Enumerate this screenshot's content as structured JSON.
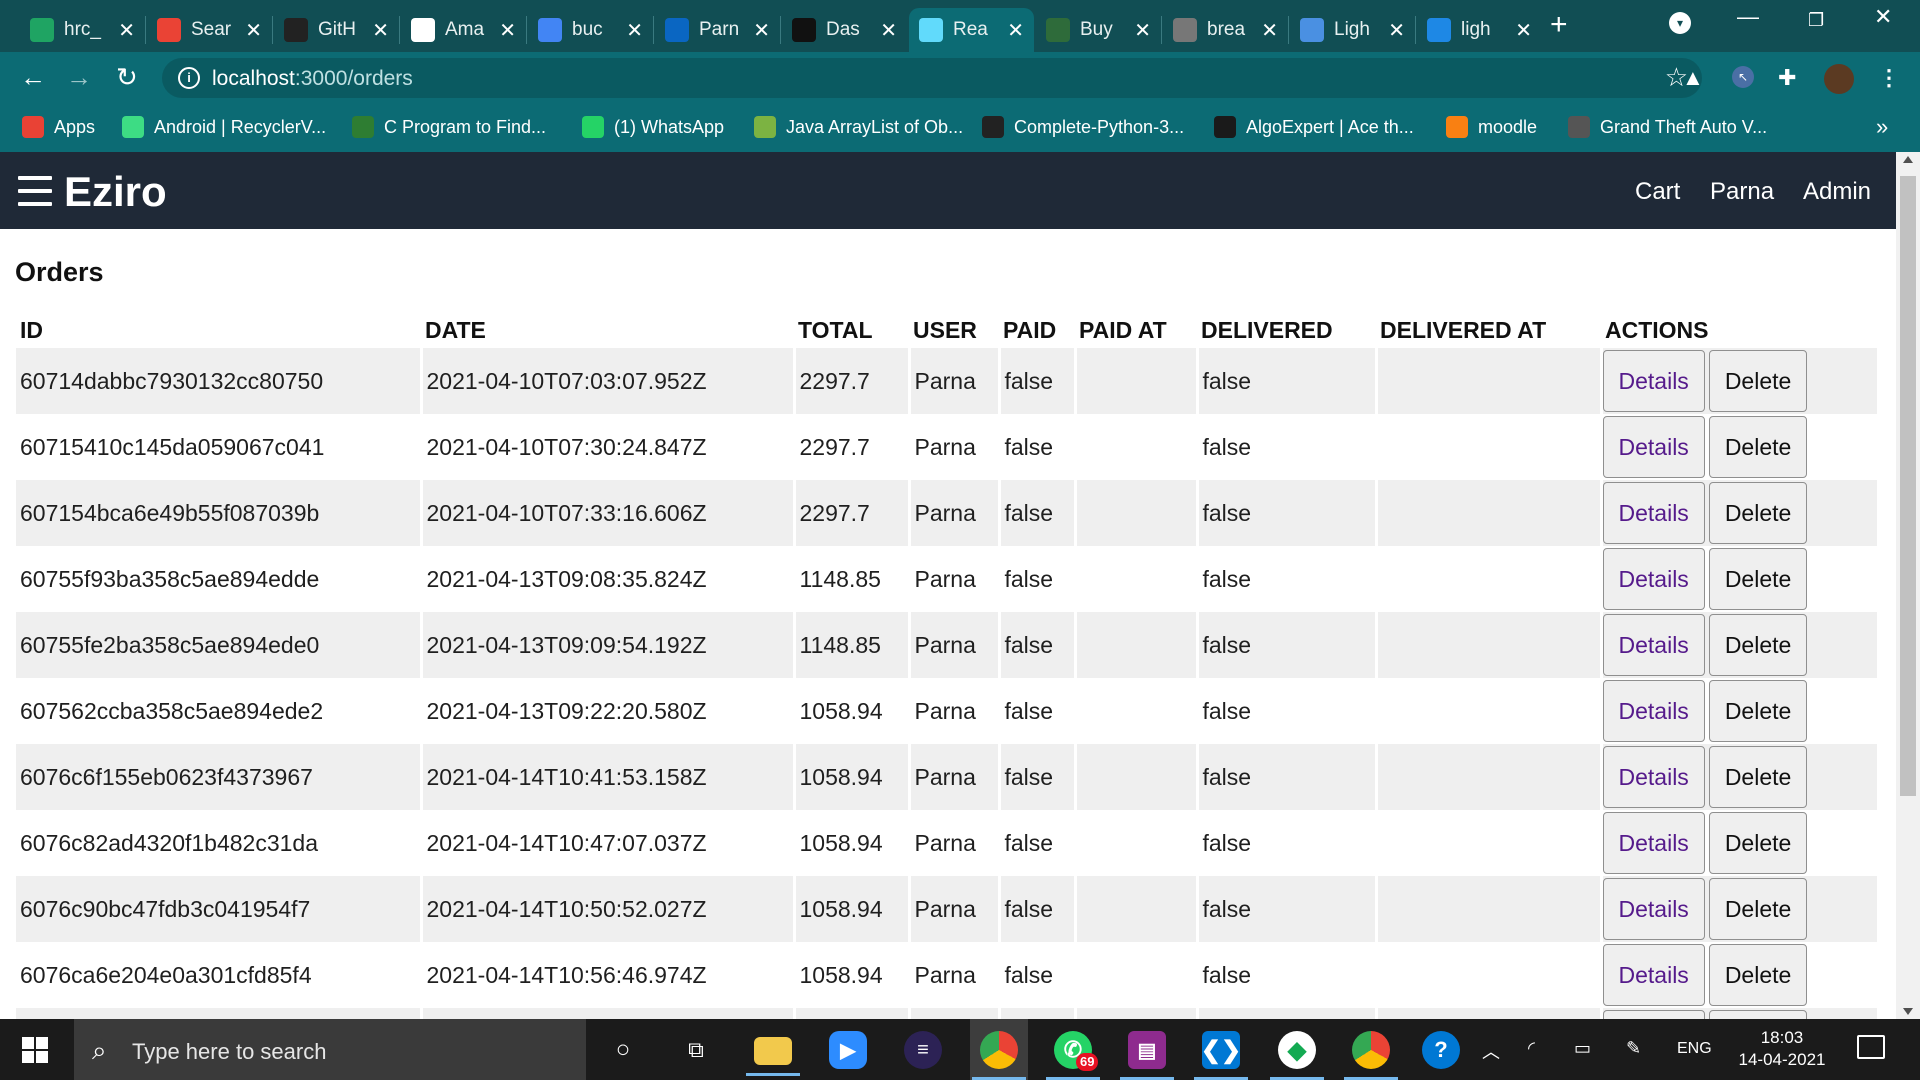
{
  "browser": {
    "tabs": [
      {
        "title": "hrc_",
        "icon": "google-drive-icon",
        "color": "#1fa463"
      },
      {
        "title": "Sear",
        "icon": "gmail-icon",
        "color": "#ea4335"
      },
      {
        "title": "GitH",
        "icon": "github-icon",
        "color": "#222222"
      },
      {
        "title": "Ama",
        "icon": "amazon-icon",
        "color": "#ffffff"
      },
      {
        "title": "buc",
        "icon": "google-icon",
        "color": "#4285f4"
      },
      {
        "title": "Parn",
        "icon": "linkedin-icon",
        "color": "#0a66c2"
      },
      {
        "title": "Das",
        "icon": "dashboard-icon",
        "color": "#111111"
      },
      {
        "title": "Rea",
        "icon": "react-icon",
        "color": "#61dafb"
      },
      {
        "title": "Buy",
        "icon": "shop-icon",
        "color": "#2e6b3a"
      },
      {
        "title": "brea",
        "icon": "globe-icon",
        "color": "#777777"
      },
      {
        "title": "Ligh",
        "icon": "colory-icon",
        "color": "#4a90e2"
      },
      {
        "title": "ligh",
        "icon": "c-icon",
        "color": "#1e88e5"
      }
    ],
    "url_host": "localhost",
    "url_path": ":3000/orders",
    "bookmarks": [
      {
        "label": "Apps",
        "icon": "apps-grid-icon",
        "color": "#e94235"
      },
      {
        "label": "Android | RecyclerV...",
        "icon": "android-icon",
        "color": "#3ddc84"
      },
      {
        "label": "C Program to Find...",
        "icon": "site-icon",
        "color": "#2e7d32"
      },
      {
        "label": "(1) WhatsApp",
        "icon": "whatsapp-icon",
        "color": "#25d366"
      },
      {
        "label": "Java ArrayList of Ob...",
        "icon": "b-icon",
        "color": "#7cb342"
      },
      {
        "label": "Complete-Python-3...",
        "icon": "github-icon",
        "color": "#222222"
      },
      {
        "label": "AlgoExpert | Ace th...",
        "icon": "algoexpert-icon",
        "color": "#1a1a1a"
      },
      {
        "label": "moodle",
        "icon": "moodle-icon",
        "color": "#f98012"
      },
      {
        "label": "Grand Theft Auto V...",
        "icon": "game-icon",
        "color": "#555555"
      }
    ]
  },
  "app": {
    "brand": "Eziro",
    "nav": [
      "Cart",
      "Parna",
      "Admin"
    ],
    "page_title": "Orders"
  },
  "table": {
    "columns": [
      "ID",
      "DATE",
      "TOTAL",
      "USER",
      "PAID",
      "PAID AT",
      "DELIVERED",
      "DELIVERED AT",
      "ACTIONS"
    ],
    "details_label": "Details",
    "delete_label": "Delete",
    "rows": [
      {
        "id": "60714dabbc7930132cc80750",
        "date": "2021-04-10T07:03:07.952Z",
        "total": "2297.7",
        "user": "Parna",
        "paid": "false",
        "paid_at": "",
        "delivered": "false",
        "delivered_at": ""
      },
      {
        "id": "60715410c145da059067c041",
        "date": "2021-04-10T07:30:24.847Z",
        "total": "2297.7",
        "user": "Parna",
        "paid": "false",
        "paid_at": "",
        "delivered": "false",
        "delivered_at": ""
      },
      {
        "id": "607154bca6e49b55f087039b",
        "date": "2021-04-10T07:33:16.606Z",
        "total": "2297.7",
        "user": "Parna",
        "paid": "false",
        "paid_at": "",
        "delivered": "false",
        "delivered_at": ""
      },
      {
        "id": "60755f93ba358c5ae894edde",
        "date": "2021-04-13T09:08:35.824Z",
        "total": "1148.85",
        "user": "Parna",
        "paid": "false",
        "paid_at": "",
        "delivered": "false",
        "delivered_at": ""
      },
      {
        "id": "60755fe2ba358c5ae894ede0",
        "date": "2021-04-13T09:09:54.192Z",
        "total": "1148.85",
        "user": "Parna",
        "paid": "false",
        "paid_at": "",
        "delivered": "false",
        "delivered_at": ""
      },
      {
        "id": "607562ccba358c5ae894ede2",
        "date": "2021-04-13T09:22:20.580Z",
        "total": "1058.94",
        "user": "Parna",
        "paid": "false",
        "paid_at": "",
        "delivered": "false",
        "delivered_at": ""
      },
      {
        "id": "6076c6f155eb0623f4373967",
        "date": "2021-04-14T10:41:53.158Z",
        "total": "1058.94",
        "user": "Parna",
        "paid": "false",
        "paid_at": "",
        "delivered": "false",
        "delivered_at": ""
      },
      {
        "id": "6076c82ad4320f1b482c31da",
        "date": "2021-04-14T10:47:07.037Z",
        "total": "1058.94",
        "user": "Parna",
        "paid": "false",
        "paid_at": "",
        "delivered": "false",
        "delivered_at": ""
      },
      {
        "id": "6076c90bc47fdb3c041954f7",
        "date": "2021-04-14T10:50:52.027Z",
        "total": "1058.94",
        "user": "Parna",
        "paid": "false",
        "paid_at": "",
        "delivered": "false",
        "delivered_at": ""
      },
      {
        "id": "6076ca6e204e0a301cfd85f4",
        "date": "2021-04-14T10:56:46.974Z",
        "total": "1058.94",
        "user": "Parna",
        "paid": "false",
        "paid_at": "",
        "delivered": "false",
        "delivered_at": ""
      },
      {
        "id": "",
        "date": "",
        "total": "",
        "user": "",
        "paid": "",
        "paid_at": "",
        "delivered": "",
        "delivered_at": ""
      }
    ]
  },
  "taskbar": {
    "search_placeholder": "Type here to search",
    "whatsapp_badge": "69",
    "language": "ENG",
    "time": "18:03",
    "date": "14-04-2021"
  }
}
